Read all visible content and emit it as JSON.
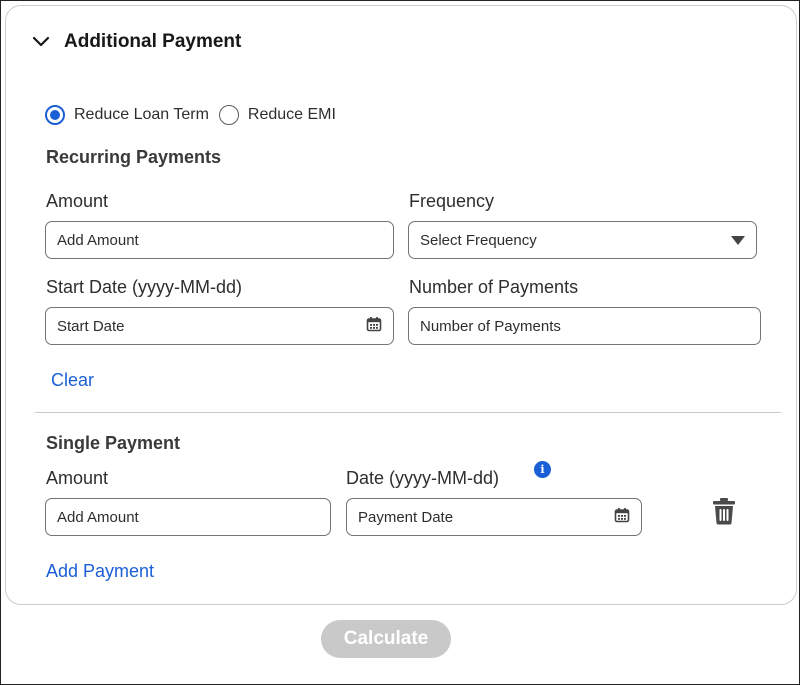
{
  "section": {
    "title": "Additional Payment",
    "expanded": true,
    "icon": "chevron-down-icon"
  },
  "loan_option": {
    "options": [
      "Reduce Loan Term",
      "Reduce EMI"
    ],
    "selected": "Reduce Loan Term"
  },
  "recurring": {
    "title": "Recurring Payments",
    "amount_label": "Amount",
    "amount_placeholder": "Add Amount",
    "frequency_label": "Frequency",
    "frequency_value": "Select Frequency",
    "start_date_label": "Start Date (yyyy-MM-dd)",
    "start_date_placeholder": "Start Date",
    "num_payments_label": "Number of Payments",
    "num_payments_placeholder": "Number of Payments",
    "clear_label": "Clear"
  },
  "single": {
    "title": "Single Payment",
    "amount_label": "Amount",
    "amount_placeholder": "Add Amount",
    "date_label": "Date (yyyy-MM-dd)",
    "date_placeholder": "Payment Date",
    "info_icon": "i",
    "add_payment_label": "Add Payment"
  },
  "calculate_label": "Calculate",
  "colors": {
    "accent": "#1b5fd6",
    "disabled_button": "#c9c9c9"
  }
}
